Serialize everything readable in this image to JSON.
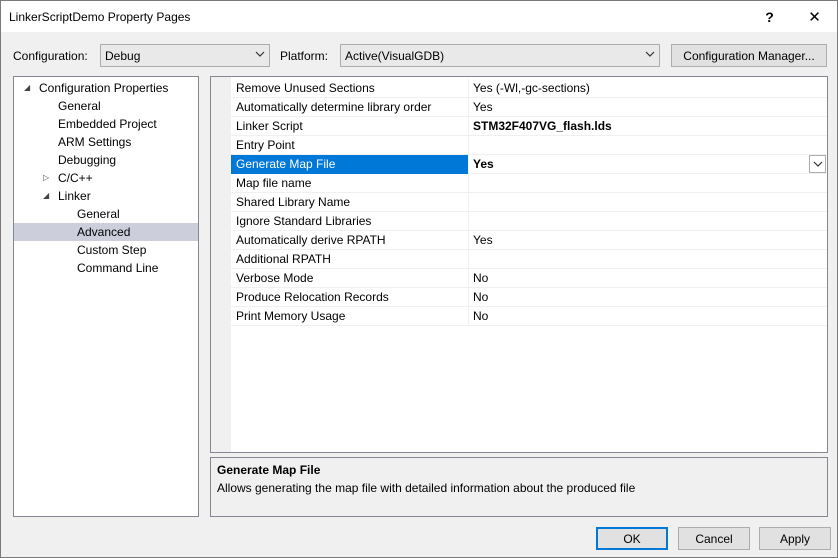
{
  "window": {
    "title": "LinkerScriptDemo Property Pages",
    "help_glyph": "?",
    "close_glyph": "✕"
  },
  "toolbar": {
    "configuration_label": "Configuration:",
    "configuration_value": "Debug",
    "platform_label": "Platform:",
    "platform_value": "Active(VisualGDB)",
    "config_manager_label": "Configuration Manager..."
  },
  "tree": {
    "items": [
      {
        "label": "Configuration Properties",
        "expander": "◢"
      },
      {
        "label": "General"
      },
      {
        "label": "Embedded Project"
      },
      {
        "label": "ARM Settings"
      },
      {
        "label": "Debugging"
      },
      {
        "label": "C/C++",
        "expander": "▷"
      },
      {
        "label": "Linker",
        "expander": "◢"
      },
      {
        "label": "General"
      },
      {
        "label": "Advanced"
      },
      {
        "label": "Custom Step"
      },
      {
        "label": "Command Line"
      }
    ]
  },
  "grid": {
    "rows": [
      {
        "name": "Remove Unused Sections",
        "value": "Yes (-Wl,-gc-sections)"
      },
      {
        "name": "Automatically determine library order",
        "value": "Yes"
      },
      {
        "name": "Linker Script",
        "value": "STM32F407VG_flash.lds"
      },
      {
        "name": "Entry Point",
        "value": ""
      },
      {
        "name": "Generate Map File",
        "value": "Yes"
      },
      {
        "name": "Map file name",
        "value": ""
      },
      {
        "name": "Shared Library Name",
        "value": ""
      },
      {
        "name": "Ignore Standard Libraries",
        "value": ""
      },
      {
        "name": "Automatically derive RPATH",
        "value": "Yes"
      },
      {
        "name": "Additional RPATH",
        "value": ""
      },
      {
        "name": "Verbose Mode",
        "value": "No"
      },
      {
        "name": "Produce Relocation Records",
        "value": "No"
      },
      {
        "name": "Print Memory Usage",
        "value": "No"
      }
    ]
  },
  "description": {
    "title": "Generate Map File",
    "text": "Allows generating the map file with detailed information about the produced file"
  },
  "buttons": {
    "ok": "OK",
    "cancel": "Cancel",
    "apply": "Apply"
  },
  "icons": {
    "dropdown": "chevron-down-icon",
    "dropdown_glyph": "⌵"
  },
  "colors": {
    "selection": "#0078d7",
    "tree_selection": "#cccedb"
  }
}
